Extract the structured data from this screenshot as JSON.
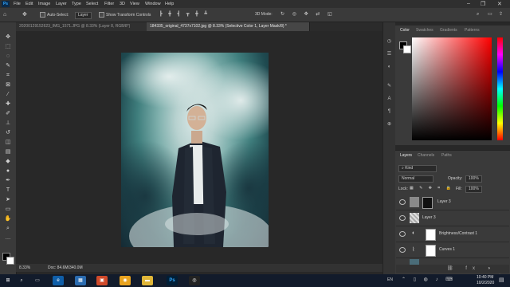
{
  "menubar": {
    "app_badge": "Ps",
    "items": [
      "File",
      "Edit",
      "Image",
      "Layer",
      "Type",
      "Select",
      "Filter",
      "3D",
      "View",
      "Window",
      "Help"
    ]
  },
  "options": {
    "auto_select": "Auto-Select:",
    "auto_select_mode": "Layer",
    "show_transform": "Show Transform Controls",
    "mode_3d": "3D Mode:"
  },
  "tabs": [
    {
      "label": "20200129152623_IMG_1571.JPG @ 8.33% (Layer 8, RGB/8*)",
      "active": false
    },
    {
      "label": "184335_original_4737x7102.jpg @ 8.33% (Selective Color 1, Layer Mask/8) *",
      "active": true
    }
  ],
  "status": {
    "zoom": "8.33%",
    "doc": "Doc: 84.6M/340.0M"
  },
  "color_panel": {
    "tabs": [
      "Color",
      "Swatches",
      "Gradients",
      "Patterns"
    ]
  },
  "layers_panel": {
    "tabs": [
      "Layers",
      "Channels",
      "Paths"
    ],
    "kind": "Kind",
    "blend": "Normal",
    "opacity_label": "Opacity:",
    "opacity": "100%",
    "lock_label": "Lock:",
    "fill_label": "Fill:",
    "fill": "100%",
    "layers": [
      {
        "name": "Layer 3"
      },
      {
        "name": "Layer 3"
      },
      {
        "name": "Brightness/Contrast 1"
      },
      {
        "name": "Curves 1"
      }
    ]
  },
  "taskbar": {
    "lang": "EN",
    "time": "10:40 PM",
    "date": "10/2/2020"
  },
  "colors": {
    "accent": "#31a8ff",
    "taskbar": "#121b2b",
    "panel": "#3a3a3a"
  }
}
